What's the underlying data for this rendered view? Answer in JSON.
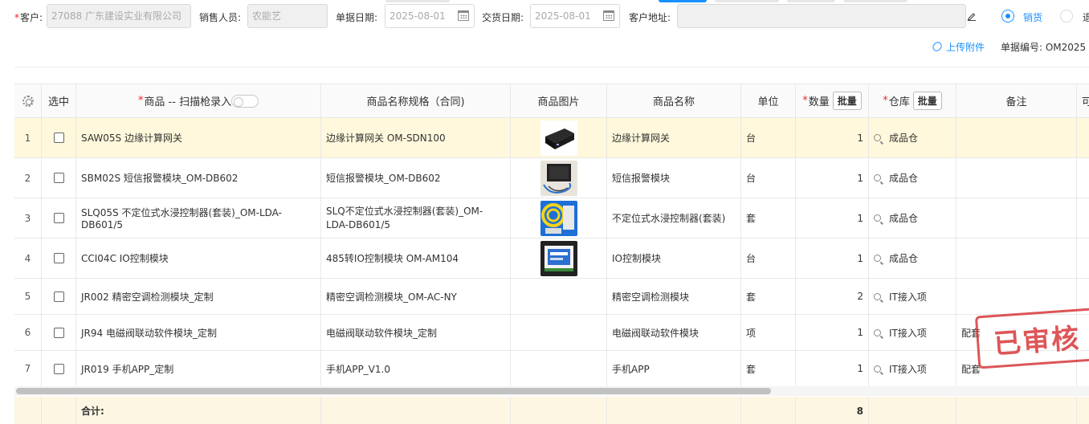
{
  "header": {
    "customer_label": "客户:",
    "customer_value": "27088 广东建设实业有限公司",
    "salesperson_label": "销售人员:",
    "salesperson_value": "农能艺",
    "doc_date_label": "单据日期:",
    "doc_date_value": "2025-08-01",
    "delivery_date_label": "交货日期:",
    "delivery_date_value": "2025-08-01",
    "address_label": "客户地址:",
    "address_value": "",
    "radio_sale_label": "销货",
    "radio_return_label": "退",
    "upload_label": "上传附件",
    "doc_no_label": "单据编号: OM2025"
  },
  "grid": {
    "columns": {
      "select": "选中",
      "product": "商品 -- 扫描枪录入",
      "spec": "商品名称规格（合同)",
      "image": "商品图片",
      "name": "商品名称",
      "unit": "单位",
      "qty": "数量",
      "warehouse": "仓库",
      "remark": "备注",
      "more": "可"
    },
    "bulk_label": "批量",
    "rows": [
      {
        "idx": "1",
        "product": "SAW05S 边缘计算网关",
        "spec": "边缘计算网关 OM-SDN100",
        "name": "边缘计算网关",
        "unit": "台",
        "qty": "1",
        "warehouse": "成品仓",
        "remark": ""
      },
      {
        "idx": "2",
        "product": "SBM02S 短信报警模块_OM-DB602",
        "spec": "短信报警模块_OM-DB602",
        "name": "短信报警模块",
        "unit": "台",
        "qty": "1",
        "warehouse": "成品仓",
        "remark": ""
      },
      {
        "idx": "3",
        "product": "SLQ05S 不定位式水浸控制器(套装)_OM-LDA-DB601/5",
        "spec": "SLQ不定位式水浸控制器(套装)_OM-LDA-DB601/5",
        "name": "不定位式水浸控制器(套装)",
        "unit": "套",
        "qty": "1",
        "warehouse": "成品仓",
        "remark": ""
      },
      {
        "idx": "4",
        "product": "CCI04C IO控制模块",
        "spec": "485转IO控制模块 OM-AM104",
        "name": "IO控制模块",
        "unit": "台",
        "qty": "1",
        "warehouse": "成品仓",
        "remark": ""
      },
      {
        "idx": "5",
        "product": "JR002 精密空调检测模块_定制",
        "spec": "精密空调检测模块_OM-AC-NY",
        "name": "精密空调检测模块",
        "unit": "套",
        "qty": "2",
        "warehouse": "IT接入项",
        "remark": ""
      },
      {
        "idx": "6",
        "product": "JR94 电磁阀联动软件模块_定制",
        "spec": "电磁阀联动软件模块_定制",
        "name": "电磁阀联动软件模块",
        "unit": "项",
        "qty": "1",
        "warehouse": "IT接入项",
        "remark": "配套"
      },
      {
        "idx": "7",
        "product": "JR019 手机APP_定制",
        "spec": "手机APP_V1.0",
        "name": "手机APP",
        "unit": "套",
        "qty": "1",
        "warehouse": "IT接入项",
        "remark": "配套"
      }
    ],
    "footer": {
      "label": "合计:",
      "qty_total": "8"
    }
  },
  "stamp_text": "已审核",
  "colors": {
    "accent": "#1890ff",
    "stamp": "#d8393b",
    "row_highlight": "#fff8dc",
    "required": "#f5222d"
  }
}
